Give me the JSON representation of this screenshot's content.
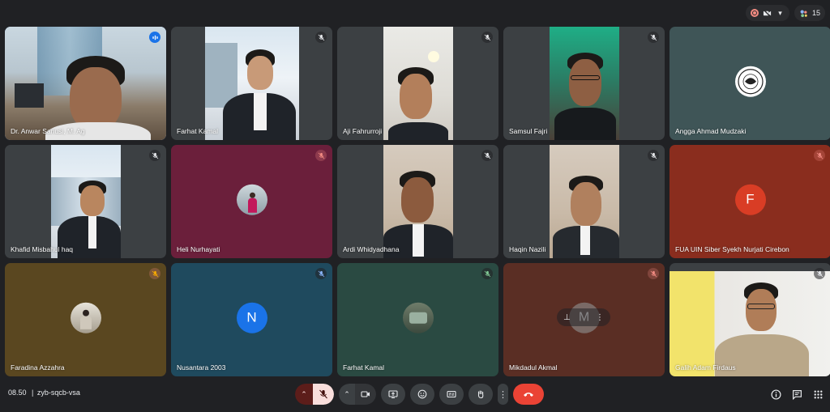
{
  "topbar": {
    "participants_count": "15"
  },
  "participants": [
    {
      "name": "Dr. Anwar Sanusi, M. Ag",
      "mic": "speaking",
      "kind": "video"
    },
    {
      "name": "Farhat Kamal",
      "mic": "muted",
      "kind": "video"
    },
    {
      "name": "Aji Fahrurroji",
      "mic": "muted",
      "kind": "video"
    },
    {
      "name": "Samsul Fajri",
      "mic": "muted",
      "kind": "video"
    },
    {
      "name": "Angga Ahmad Mudzaki",
      "mic": "none",
      "kind": "avatar",
      "bg": "#3f5557"
    },
    {
      "name": "Khafid Misbahul haq",
      "mic": "muted",
      "kind": "video"
    },
    {
      "name": "Heli Nurhayati",
      "mic": "muted-red",
      "kind": "avatar",
      "bg": "#6b1f3b"
    },
    {
      "name": "Ardi Whidyadhana",
      "mic": "muted",
      "kind": "video"
    },
    {
      "name": "Haqin Nazili",
      "mic": "muted",
      "kind": "video"
    },
    {
      "name": "FUA UIN Siber Syekh Nurjati Cirebon",
      "mic": "muted-red",
      "kind": "letter",
      "letter": "F",
      "bg": "#8a2d1e",
      "avatar_bg": "#d93d25"
    },
    {
      "name": "Faradina Azzahra",
      "mic": "muted-red",
      "kind": "avatar",
      "bg": "#5a4720"
    },
    {
      "name": "Nusantara 2003",
      "mic": "muted",
      "kind": "letter",
      "letter": "N",
      "bg": "#1f4a5e",
      "avatar_bg": "#1a73e8"
    },
    {
      "name": "Farhat Kamal",
      "mic": "muted",
      "kind": "avatar",
      "bg": "#2a4a42"
    },
    {
      "name": "Mikdadul Akmal",
      "mic": "muted-red",
      "kind": "avatar",
      "bg": "#5a2e24",
      "letter": "M"
    },
    {
      "name": "Galih Adam Firdaus",
      "mic": "muted",
      "kind": "video"
    }
  ],
  "bottombar": {
    "time": "08.50",
    "meeting_code": "zyb-sqcb-vsa"
  },
  "colors": {
    "background": "#202124",
    "tile": "#3c4043",
    "end_call": "#ea4335",
    "active_outline": "#8ab4f8",
    "speaking": "#1a73e8"
  },
  "icons": {
    "controls": [
      "chevron-up-icon",
      "mic-off-icon",
      "chevron-up-icon",
      "camera-icon",
      "present-icon",
      "emoji-icon",
      "captions-icon",
      "hand-icon",
      "more-vert-icon",
      "call-end-icon"
    ],
    "right": [
      "info-icon",
      "chat-icon",
      "apps-icon"
    ]
  }
}
